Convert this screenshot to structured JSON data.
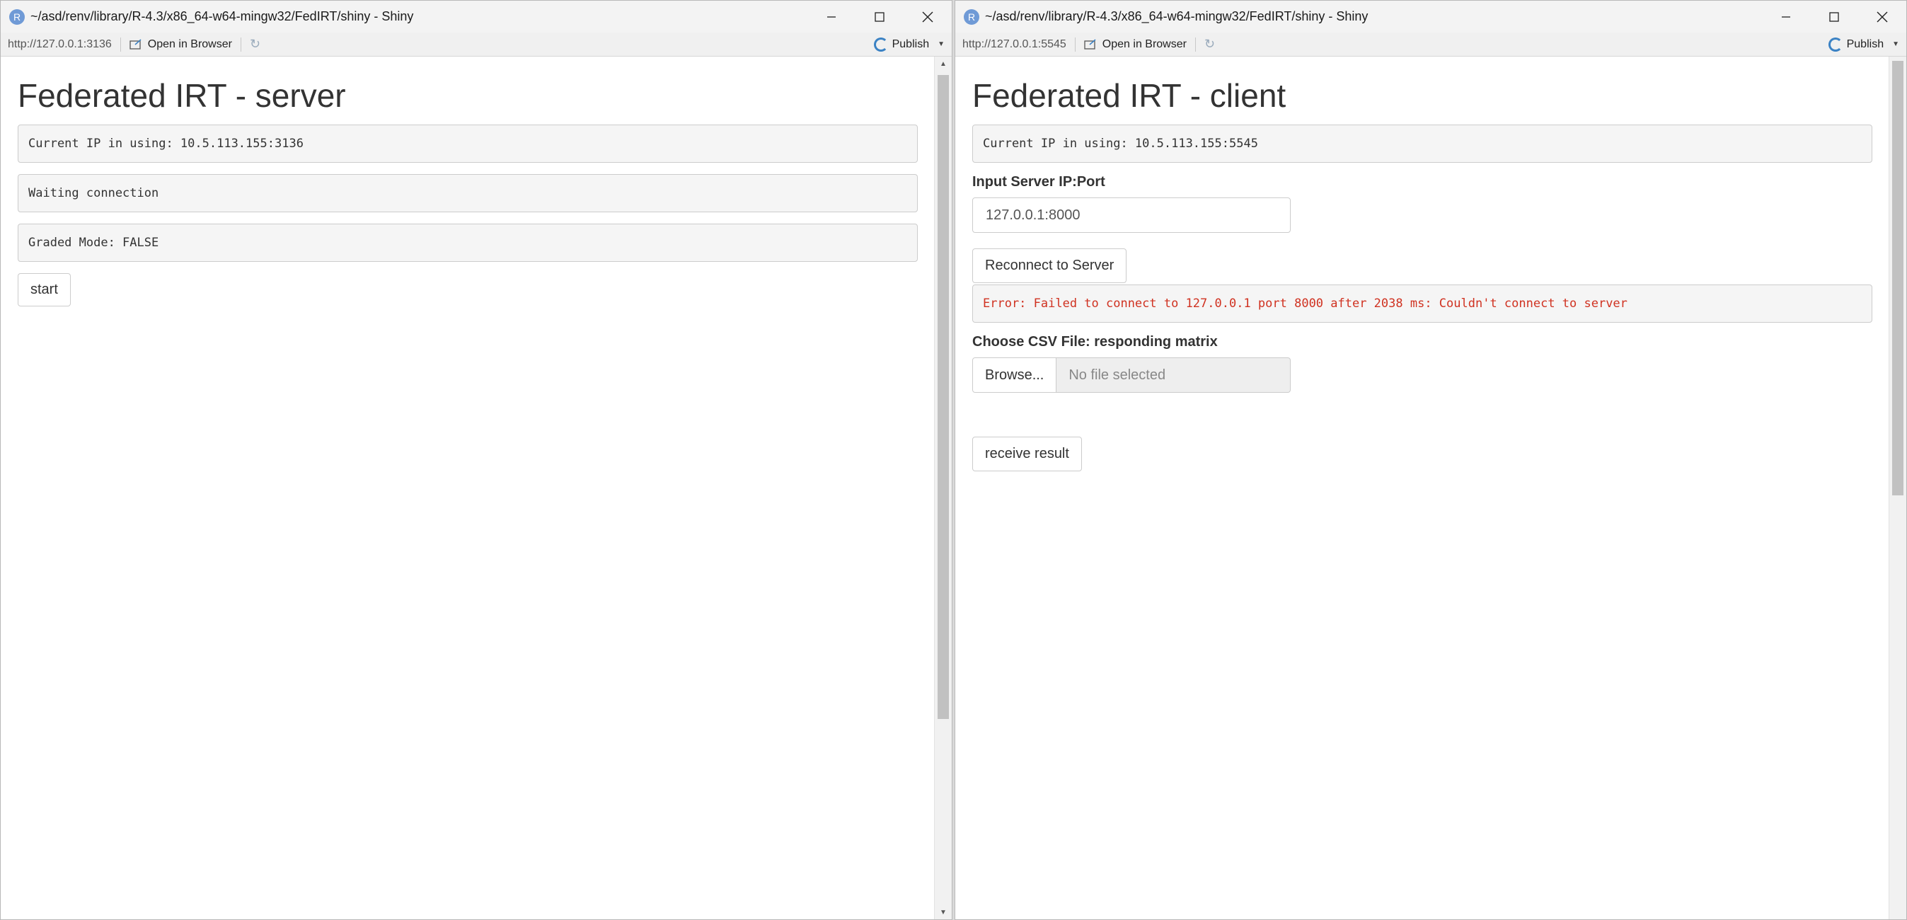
{
  "left_window": {
    "title": "~/asd/renv/library/R-4.3/x86_64-w64-mingw32/FedIRT/shiny - Shiny",
    "toolbar": {
      "url": "http://127.0.0.1:3136",
      "open_in_browser": "Open in Browser",
      "publish": "Publish"
    },
    "page": {
      "heading": "Federated IRT - server",
      "ip_output": "Current IP in using: 10.5.113.155:3136",
      "status_output": "Waiting connection",
      "graded_output": "Graded Mode: FALSE",
      "start_button": "start"
    }
  },
  "right_window": {
    "title": "~/asd/renv/library/R-4.3/x86_64-w64-mingw32/FedIRT/shiny - Shiny",
    "toolbar": {
      "url": "http://127.0.0.1:5545",
      "open_in_browser": "Open in Browser",
      "publish": "Publish"
    },
    "page": {
      "heading": "Federated IRT - client",
      "ip_output": "Current IP in using: 10.5.113.155:5545",
      "server_input_label": "Input Server IP:Port",
      "server_input_value": "127.0.0.1:8000",
      "reconnect_button": "Reconnect to Server",
      "error_output": "Error: Failed to connect to 127.0.0.1 port 8000 after 2038 ms: Couldn't connect to server",
      "csv_label": "Choose CSV File: responding matrix",
      "browse_button": "Browse...",
      "file_placeholder": "No file selected",
      "receive_button": "receive result"
    }
  },
  "icons": {
    "app": "r-logo-icon",
    "minimize": "minimize-icon",
    "maximize": "maximize-icon",
    "close": "close-icon",
    "open_browser": "open-in-browser-icon",
    "refresh": "refresh-icon",
    "publish": "publish-icon"
  },
  "colors": {
    "error_text": "#d03221",
    "well_background": "#f5f5f5",
    "publish_icon": "#3b82c4"
  }
}
